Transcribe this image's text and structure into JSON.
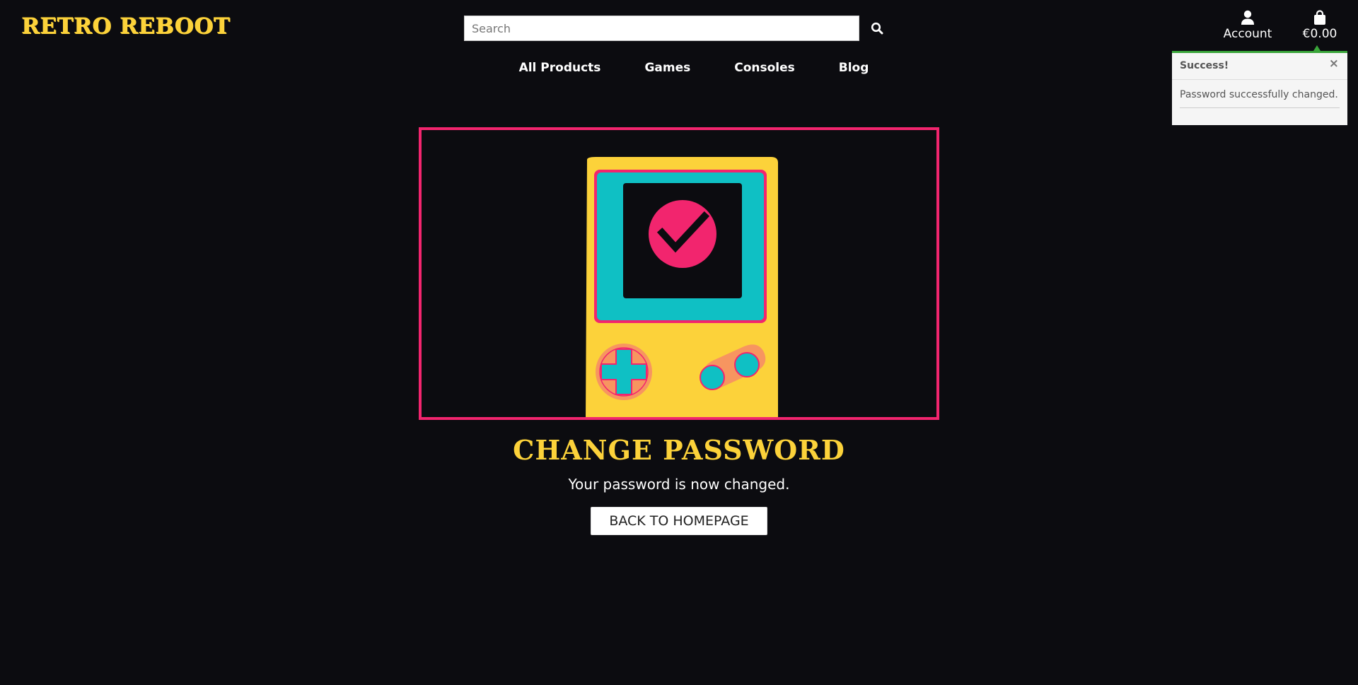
{
  "brand": {
    "logo_text": "RETRO REBOOT",
    "accent": "#fcd23a",
    "highlight": "#f2256e"
  },
  "search": {
    "placeholder": "Search"
  },
  "header": {
    "account_label": "Account",
    "cart_total": "€0.00"
  },
  "nav": {
    "items": [
      {
        "label": "All Products"
      },
      {
        "label": "Games"
      },
      {
        "label": "Consoles"
      },
      {
        "label": "Blog"
      }
    ]
  },
  "toast": {
    "title": "Success!",
    "close": "×",
    "message": "Password successfully changed.",
    "status_color": "#3aa53a"
  },
  "main": {
    "title": "CHANGE PASSWORD",
    "message": "Your password is now changed.",
    "button_label": "BACK TO HOMEPAGE"
  },
  "icons": {
    "search": "search-icon",
    "account": "user-icon",
    "cart": "shopping-bag-icon",
    "hero": "handheld-console-checkmark-illustration"
  }
}
